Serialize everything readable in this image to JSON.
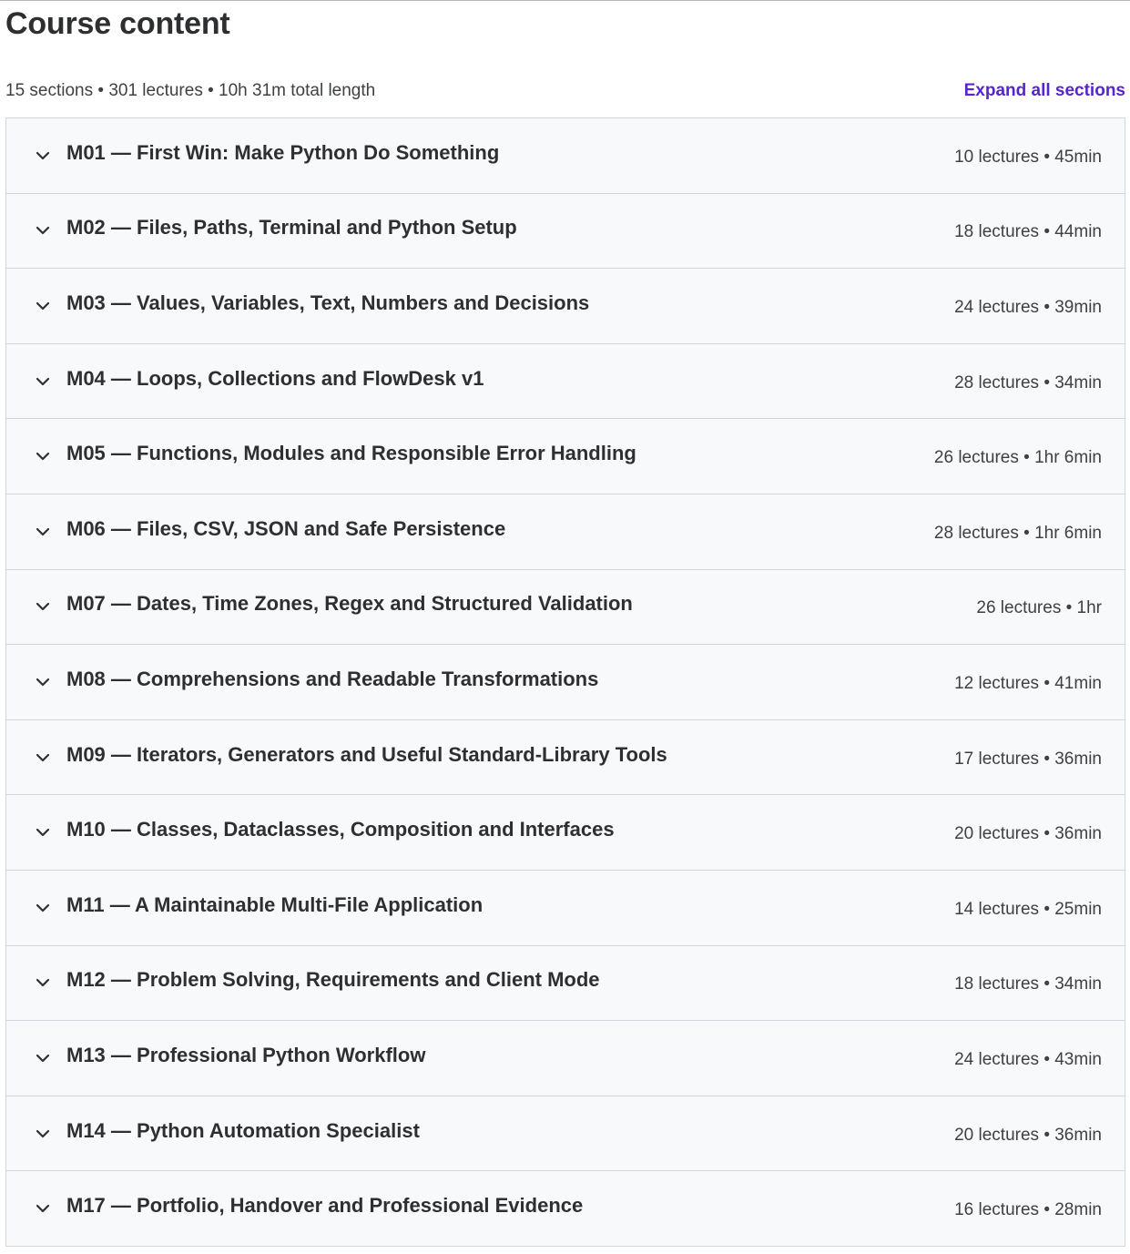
{
  "header": {
    "title": "Course content",
    "summary": "15 sections • 301 lectures • 10h 31m total length",
    "expand_label": "Expand all sections"
  },
  "colors": {
    "accent": "#5624d0",
    "row_bg": "#f7f9fa",
    "border": "#d1d7dc",
    "text": "#2d2f31"
  },
  "sections": [
    {
      "title": "M01 — First Win: Make Python Do Something",
      "meta": "10 lectures • 45min",
      "icon": "chevron-down-icon"
    },
    {
      "title": "M02 — Files, Paths, Terminal and Python Setup",
      "meta": "18 lectures • 44min",
      "icon": "chevron-down-icon"
    },
    {
      "title": "M03 — Values, Variables, Text, Numbers and Decisions",
      "meta": "24 lectures • 39min",
      "icon": "chevron-down-icon"
    },
    {
      "title": "M04 — Loops, Collections and FlowDesk v1",
      "meta": "28 lectures • 34min",
      "icon": "chevron-down-icon"
    },
    {
      "title": "M05 — Functions, Modules and Responsible Error Handling",
      "meta": "26 lectures • 1hr 6min",
      "icon": "chevron-down-icon"
    },
    {
      "title": "M06 — Files, CSV, JSON and Safe Persistence",
      "meta": "28 lectures • 1hr 6min",
      "icon": "chevron-down-icon"
    },
    {
      "title": "M07 — Dates, Time Zones, Regex and Structured Validation",
      "meta": "26 lectures • 1hr",
      "icon": "chevron-down-icon"
    },
    {
      "title": "M08 — Comprehensions and Readable Transformations",
      "meta": "12 lectures • 41min",
      "icon": "chevron-down-icon"
    },
    {
      "title": "M09 — Iterators, Generators and Useful Standard-Library Tools",
      "meta": "17 lectures • 36min",
      "icon": "chevron-down-icon"
    },
    {
      "title": "M10 — Classes, Dataclasses, Composition and Interfaces",
      "meta": "20 lectures • 36min",
      "icon": "chevron-down-icon"
    },
    {
      "title": "M11 — A Maintainable Multi-File Application",
      "meta": "14 lectures • 25min",
      "icon": "chevron-down-icon"
    },
    {
      "title": "M12 — Problem Solving, Requirements and Client Mode",
      "meta": "18 lectures • 34min",
      "icon": "chevron-down-icon"
    },
    {
      "title": "M13 — Professional Python Workflow",
      "meta": "24 lectures • 43min",
      "icon": "chevron-down-icon"
    },
    {
      "title": "M14 — Python Automation Specialist",
      "meta": "20 lectures • 36min",
      "icon": "chevron-down-icon"
    },
    {
      "title": "M17 — Portfolio, Handover and Professional Evidence",
      "meta": "16 lectures • 28min",
      "icon": "chevron-down-icon"
    }
  ]
}
